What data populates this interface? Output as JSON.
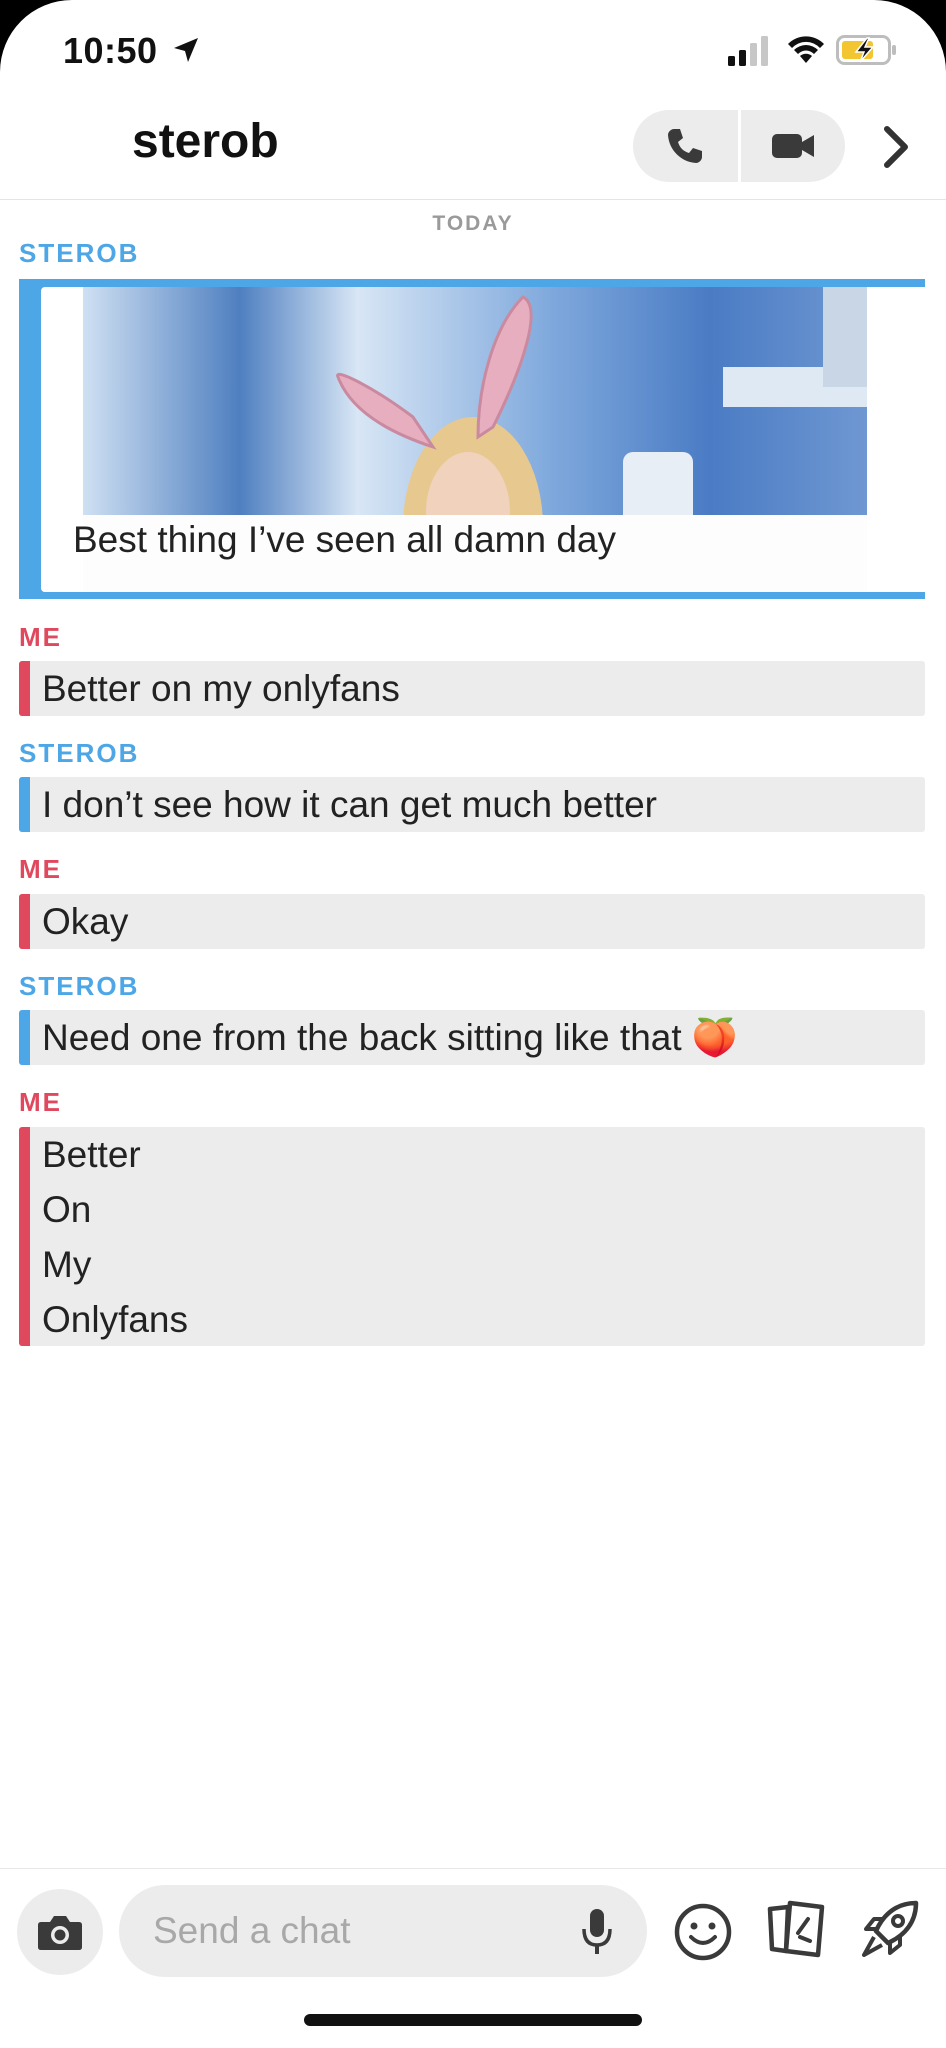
{
  "status_bar": {
    "time": "10:50"
  },
  "header": {
    "title": "sterob"
  },
  "day_separator": "TODAY",
  "messages": [
    {
      "sender": "STEROB",
      "side": "them",
      "type": "snap",
      "caption": "Best thing I’ve seen all damn day"
    },
    {
      "sender": "ME",
      "side": "me",
      "type": "text",
      "text": "Better on my onlyfans"
    },
    {
      "sender": "STEROB",
      "side": "them",
      "type": "text",
      "text": "I don’t see how it can get much better"
    },
    {
      "sender": "ME",
      "side": "me",
      "type": "text",
      "text": "Okay"
    },
    {
      "sender": "STEROB",
      "side": "them",
      "type": "text",
      "text": "Need one from the back sitting like that 🍑"
    },
    {
      "sender": "ME",
      "side": "me",
      "type": "text",
      "text": "Better\nOn\nMy\nOnlyfans"
    }
  ],
  "input": {
    "placeholder": "Send a chat"
  },
  "colors": {
    "them": "#4da6e6",
    "me": "#e0485d",
    "bubble": "#ececec"
  },
  "icons": [
    "location-arrow-icon",
    "signal-icon",
    "wifi-icon",
    "battery-charging-icon",
    "phone-icon",
    "video-camera-icon",
    "chevron-right-icon",
    "camera-icon",
    "microphone-icon",
    "emoji-icon",
    "cards-icon",
    "rocket-icon"
  ]
}
